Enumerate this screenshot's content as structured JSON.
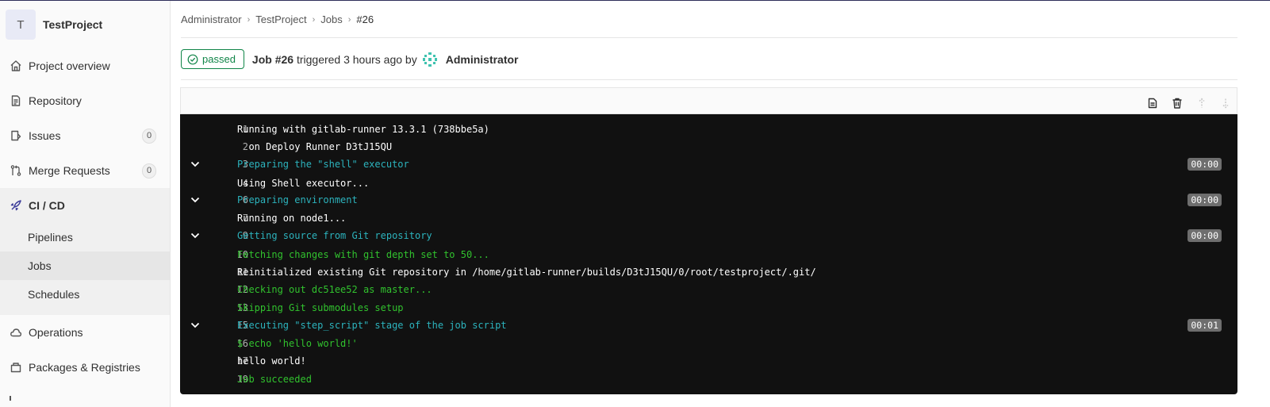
{
  "project": {
    "avatar_letter": "T",
    "name": "TestProject"
  },
  "sidebar": {
    "items": [
      {
        "label": "Project overview",
        "icon": "home-icon"
      },
      {
        "label": "Repository",
        "icon": "doc-icon"
      },
      {
        "label": "Issues",
        "icon": "issues-icon",
        "count": "0"
      },
      {
        "label": "Merge Requests",
        "icon": "merge-icon",
        "count": "0"
      },
      {
        "label": "CI / CD",
        "icon": "rocket-icon"
      },
      {
        "label": "Operations",
        "icon": "cloud-icon"
      },
      {
        "label": "Packages & Registries",
        "icon": "package-icon"
      }
    ],
    "cicd_sub": [
      {
        "label": "Pipelines"
      },
      {
        "label": "Jobs"
      },
      {
        "label": "Schedules"
      }
    ]
  },
  "breadcrumb": [
    "Administrator",
    "TestProject",
    "Jobs",
    "#26"
  ],
  "job": {
    "status": "passed",
    "job_label": "Job #26",
    "triggered": "triggered 3 hours ago by",
    "user": "Administrator"
  },
  "log": [
    {
      "n": "1",
      "text": "Running with gitlab-runner 13.3.1 (738bbe5a)",
      "color": "white"
    },
    {
      "n": "2",
      "text": "  on Deploy Runner D3tJ15QU",
      "color": "white"
    },
    {
      "n": "3",
      "text": "Preparing the \"shell\" executor",
      "color": "cyan",
      "section": true,
      "duration": "00:00"
    },
    {
      "n": "4",
      "text": "Using Shell executor...",
      "color": "white"
    },
    {
      "n": "6",
      "text": "Preparing environment",
      "color": "cyan",
      "section": true,
      "duration": "00:00"
    },
    {
      "n": "7",
      "text": "Running on node1...",
      "color": "white"
    },
    {
      "n": "9",
      "text": "Getting source from Git repository",
      "color": "cyan",
      "section": true,
      "duration": "00:00"
    },
    {
      "n": "10",
      "text": "Fetching changes with git depth set to 50...",
      "color": "green"
    },
    {
      "n": "11",
      "text": "Reinitialized existing Git repository in /home/gitlab-runner/builds/D3tJ15QU/0/root/testproject/.git/",
      "color": "white"
    },
    {
      "n": "12",
      "text": "Checking out dc51ee52 as master...",
      "color": "green"
    },
    {
      "n": "13",
      "text": "Skipping Git submodules setup",
      "color": "green"
    },
    {
      "n": "15",
      "text": "Executing \"step_script\" stage of the job script",
      "color": "cyan",
      "section": true,
      "duration": "00:01"
    },
    {
      "n": "16",
      "text": "$ echo 'hello world!'",
      "color": "green"
    },
    {
      "n": "17",
      "text": "hello world!",
      "color": "white"
    },
    {
      "n": "19",
      "text": "Job succeeded",
      "color": "green"
    }
  ]
}
